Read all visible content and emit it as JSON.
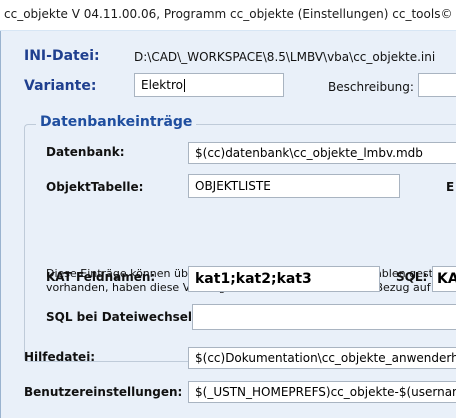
{
  "window": {
    "title": "cc_objekte V 04.11.00.06, Programm cc_objekte (Einstellungen) cc_tools©"
  },
  "ini": {
    "label": "INI-Datei:",
    "path": "D:\\CAD\\_WORKSPACE\\8.5\\LMBV\\vba\\cc_objekte.ini"
  },
  "variante": {
    "label": "Variante:",
    "value": "Elektro"
  },
  "beschreibung": {
    "label": "Beschreibung:"
  },
  "datenbank_group": {
    "title": "Datenbankeinträge",
    "datenbank_label": "Datenbank:",
    "datenbank_value": "$(cc)datenbank\\cc_objekte_lmbv.mdb",
    "objekttabelle_label": "ObjektTabelle:",
    "objekttabelle_value": "OBJEKTLISTE",
    "e_label": "E",
    "info_line1": "Diese Einträge können über MicroStation Konfigurationsvariablen gesteuert",
    "info_line2": "vorhanden, haben diese Vorrang. Im Datenbankname kann Bezug auf ande",
    "kat_label": "KAT Feldnamen:",
    "kat_value": "kat1;kat2;kat3",
    "sql_label": "SQL:",
    "sql_value": "KA",
    "sql_dateiwechsel_label": "SQL bei Dateiwechsel:",
    "sql_dateiwechsel_value": ""
  },
  "hilfedatei": {
    "label": "Hilfedatei:",
    "value": "$(cc)Dokumentation\\cc_objekte_anwenderhan"
  },
  "benutzer": {
    "label": "Benutzereinstellungen:",
    "value": "$(_USTN_HOMEPREFS)cc_objekte-$(username"
  }
}
